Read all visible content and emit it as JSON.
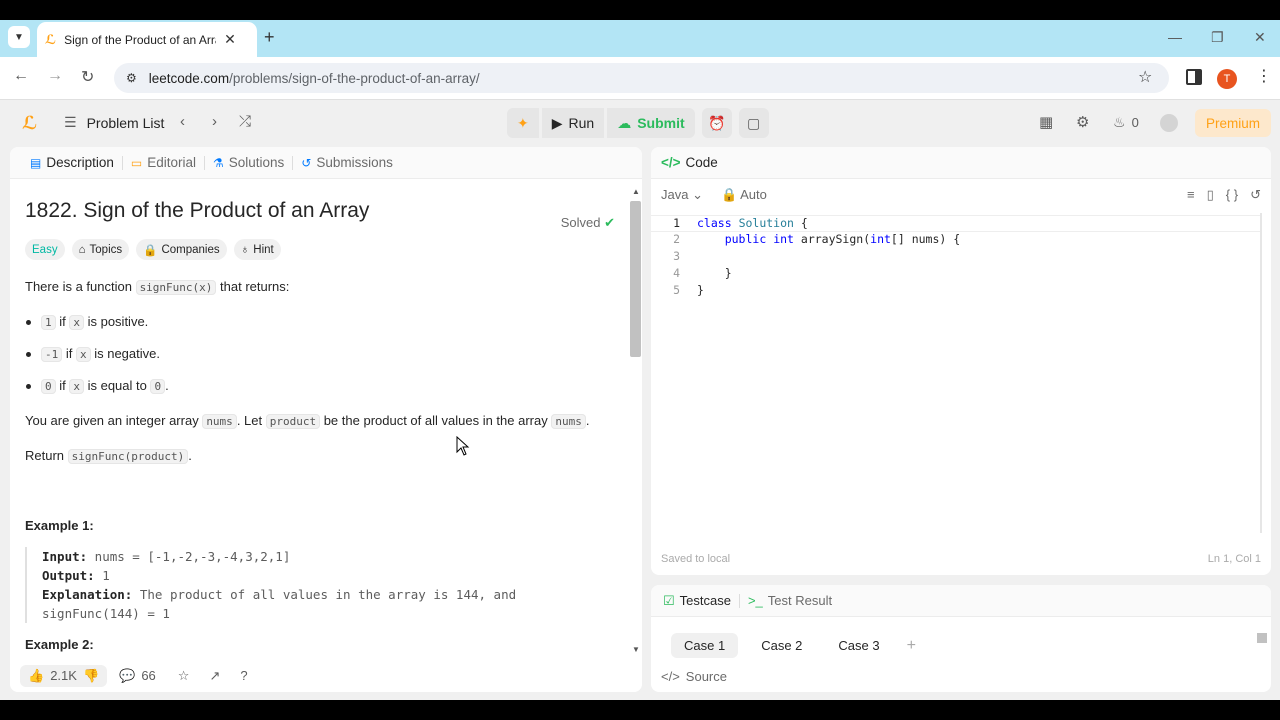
{
  "browser": {
    "tab_title": "Sign of the Product of an Array",
    "url_host": "leetcode.com",
    "url_path": "/problems/sign-of-the-product-of-an-array/",
    "profile_initial": "T"
  },
  "header": {
    "problem_list": "Problem List",
    "run": "Run",
    "submit": "Submit",
    "streak": "0",
    "premium": "Premium"
  },
  "left_tabs": [
    "Description",
    "Editorial",
    "Solutions",
    "Submissions"
  ],
  "problem": {
    "title": "1822. Sign of the Product of an Array",
    "status": "Solved",
    "tags": [
      "Easy",
      "Topics",
      "Companies",
      "Hint"
    ],
    "intro_a": "There is a function ",
    "intro_code": "signFunc(x)",
    "intro_b": " that returns:",
    "bullets": [
      {
        "code": "1",
        "a": " if ",
        "x": "x",
        "b": " is positive."
      },
      {
        "code": "-1",
        "a": " if ",
        "x": "x",
        "b": " is negative."
      },
      {
        "code": "0",
        "a": " if ",
        "x": "x",
        "b": " is equal to ",
        "c": "0",
        "d": "."
      }
    ],
    "p2_a": "You are given an integer array ",
    "p2_c1": "nums",
    "p2_b": ". Let ",
    "p2_c2": "product",
    "p2_c": " be the product of all values in the array ",
    "p2_c3": "nums",
    "p2_d": ".",
    "p3_a": "Return ",
    "p3_code": "signFunc(product)",
    "p3_b": ".",
    "example1_title": "Example 1:",
    "ex1_input_label": "Input:",
    "ex1_input": " nums = [-1,-2,-3,-4,3,2,1]",
    "ex1_output_label": "Output:",
    "ex1_output": " 1",
    "ex1_expl_label": "Explanation:",
    "ex1_expl": " The product of all values in the array is 144, and",
    "ex1_expl2": "signFunc(144) = 1",
    "example2_title": "Example 2:"
  },
  "footer": {
    "likes": "2.1K",
    "comments": "66"
  },
  "code": {
    "panel_title": "Code",
    "language": "Java",
    "mode": "Auto",
    "lines": [
      "1",
      "2",
      "3",
      "4",
      "5"
    ],
    "saved": "Saved to local",
    "position": "Ln 1, Col 1"
  },
  "tests": {
    "testcase": "Testcase",
    "result": "Test Result",
    "cases": [
      "Case 1",
      "Case 2",
      "Case 3"
    ],
    "source": "Source"
  }
}
